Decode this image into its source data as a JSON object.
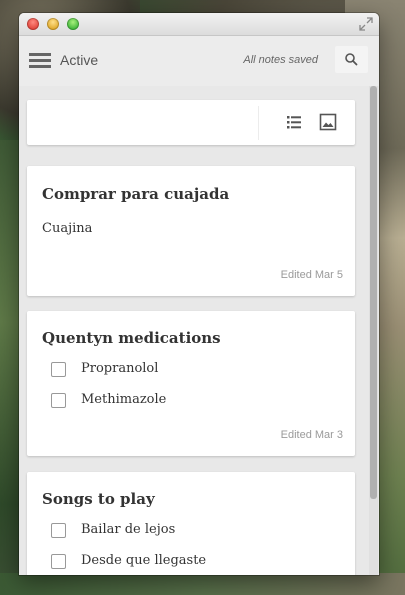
{
  "appbar": {
    "section_label": "Active",
    "status_text": "All notes saved"
  },
  "notes": [
    {
      "title": "Comprar para cuajada",
      "text": "Cuajina",
      "edited": "Edited Mar 5"
    },
    {
      "title": "Quentyn medications",
      "items": [
        "Propranolol",
        "Methimazole"
      ],
      "edited": "Edited Mar 3"
    },
    {
      "title": "Songs to play",
      "items": [
        "Bailar de lejos",
        "Desde que llegaste"
      ]
    }
  ],
  "colors": {
    "window_bg": "#e8e8e8",
    "card_bg": "#ffffff",
    "text": "#333333",
    "muted": "#9a9a9a"
  }
}
